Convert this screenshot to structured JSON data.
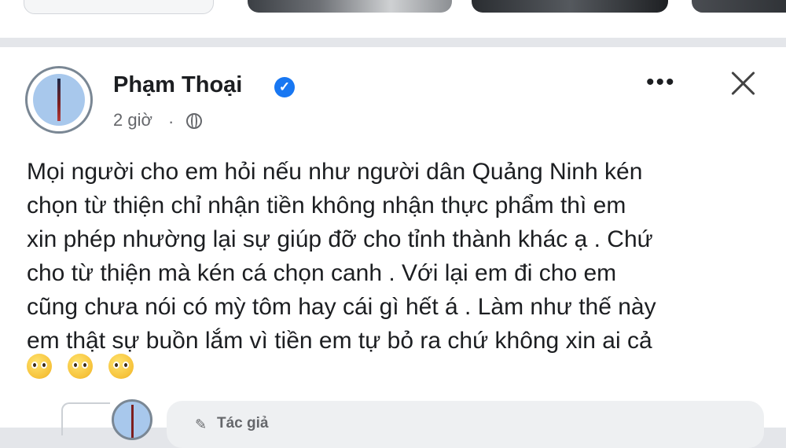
{
  "post": {
    "author_name": "Phạm Thoại",
    "verified_icon": "verified-check-icon",
    "time": "2 giờ",
    "time_separator": "·",
    "audience_icon": "globe-icon",
    "more_icon": "more-options-icon",
    "close_icon": "close-icon",
    "body_lines": [
      "Mọi người cho em hỏi nếu như người dân Quảng Ninh kén",
      "chọn từ thiện chỉ nhận tiền không nhận thực phẩm thì em",
      "xin phép nhường lại sự giúp đỡ cho tỉnh thành khác ạ . Chứ",
      "cho từ thiện mà kén cá chọn canh . Với lại em đi cho em",
      "cũng chưa nói có mỳ tôm hay cái gì hết á . Làm như thế này",
      "em thật sự buồn lắm vì tiền em tự bỏ ra chứ không xin ai cả"
    ],
    "emoji_icon": "pleading-face-emoji",
    "emoji_count": 3
  },
  "reply": {
    "author_icon": "pencil-icon",
    "author_label": "Tác giả"
  },
  "colors": {
    "accent": "#1877f2",
    "secondary_text": "#65676b",
    "background": "#e4e6ea"
  }
}
